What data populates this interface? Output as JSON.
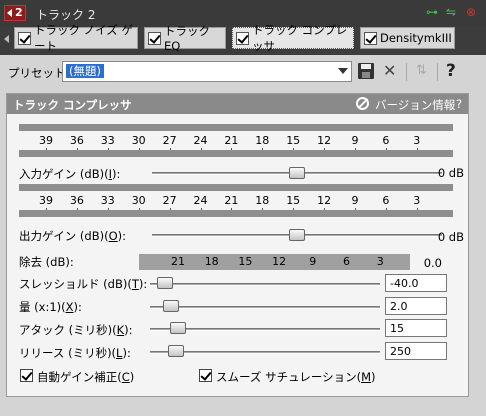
{
  "titlebar": {
    "track_number": "2",
    "title": "トラック 2"
  },
  "tabs": [
    {
      "label": "トラック ノイズ ゲート"
    },
    {
      "label": "トラック EQ"
    },
    {
      "label": "トラック コンプレッサ"
    },
    {
      "label": "DensitymkIII"
    }
  ],
  "preset": {
    "label": "プリセット:",
    "value": "(無題)"
  },
  "panel": {
    "title": "トラック コンプレッサ",
    "version_label": "バージョン情報",
    "help": "?"
  },
  "meter_scale": [
    "39",
    "36",
    "33",
    "30",
    "27",
    "24",
    "21",
    "18",
    "15",
    "12",
    "9",
    "6",
    "3"
  ],
  "input_gain": {
    "label": "入力ゲイン (dB)(",
    "key": "I",
    "suffix": "):",
    "value": "0 dB",
    "level": 0.5
  },
  "output_gain": {
    "label": "出力ゲイン (dB)(",
    "key": "O",
    "suffix": "):",
    "value": "0 dB",
    "level": 0.5
  },
  "reduction": {
    "label": "除去 (dB):",
    "scale": [
      "21",
      "18",
      "15",
      "12",
      "9",
      "6",
      "3"
    ],
    "value": "0.0"
  },
  "threshold": {
    "label": "スレッショルド (dB)(",
    "key": "T",
    "suffix": "):",
    "value": "-40.0",
    "level": 0.0
  },
  "ratio": {
    "label": "量 (x:1)(",
    "key": "X",
    "suffix": "):",
    "value": "2.0",
    "level": 0.03
  },
  "attack": {
    "label": "アタック (ミリ秒)(",
    "key": "K",
    "suffix": "):",
    "value": "15",
    "level": 0.06
  },
  "release": {
    "label": "リリース (ミリ秒)(",
    "key": "L",
    "suffix": "):",
    "value": "250",
    "level": 0.05
  },
  "auto_gain": {
    "label": "自動ゲイン補正(",
    "key": "C",
    "suffix": ")",
    "checked": true
  },
  "smooth_saturation": {
    "label": "スムーズ サチュレーション(",
    "key": "M",
    "suffix": ")",
    "checked": true
  },
  "colors": {
    "panel_header": "#8a8a8a",
    "meter": "#8e8e8e",
    "selection": "#2a6fd0",
    "track_badge": "#8a1e1e"
  }
}
